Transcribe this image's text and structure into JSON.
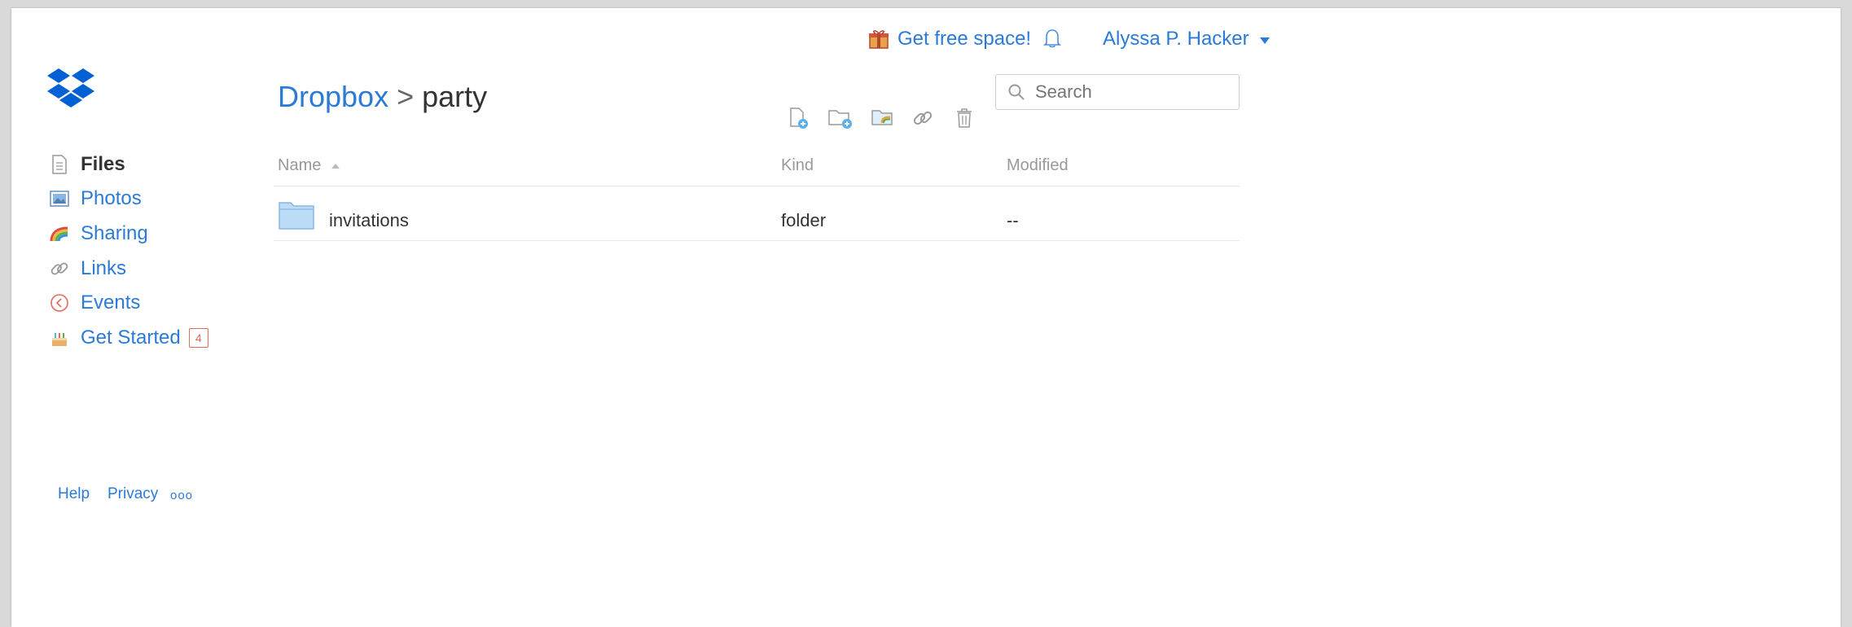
{
  "topbar": {
    "free_space": "Get free space!",
    "user_name": "Alyssa P. Hacker"
  },
  "breadcrumb": {
    "root": "Dropbox",
    "separator": ">",
    "current": "party"
  },
  "search": {
    "placeholder": "Search"
  },
  "sidebar": {
    "items": [
      {
        "label": "Files",
        "icon": "file-icon",
        "active": true
      },
      {
        "label": "Photos",
        "icon": "photo-icon"
      },
      {
        "label": "Sharing",
        "icon": "rainbow-icon"
      },
      {
        "label": "Links",
        "icon": "link-icon"
      },
      {
        "label": "Events",
        "icon": "clock-icon"
      },
      {
        "label": "Get Started",
        "icon": "cake-icon",
        "badge": "4"
      }
    ]
  },
  "table": {
    "columns": [
      "Name",
      "Kind",
      "Modified"
    ],
    "rows": [
      {
        "name": "invitations",
        "kind": "folder",
        "modified": "--"
      }
    ]
  },
  "footer": {
    "help": "Help",
    "privacy": "Privacy",
    "more": "ooo"
  },
  "colors": {
    "accent": "#2b7bd6",
    "badge": "#e06b5c",
    "folder": "#bcdcf7"
  }
}
